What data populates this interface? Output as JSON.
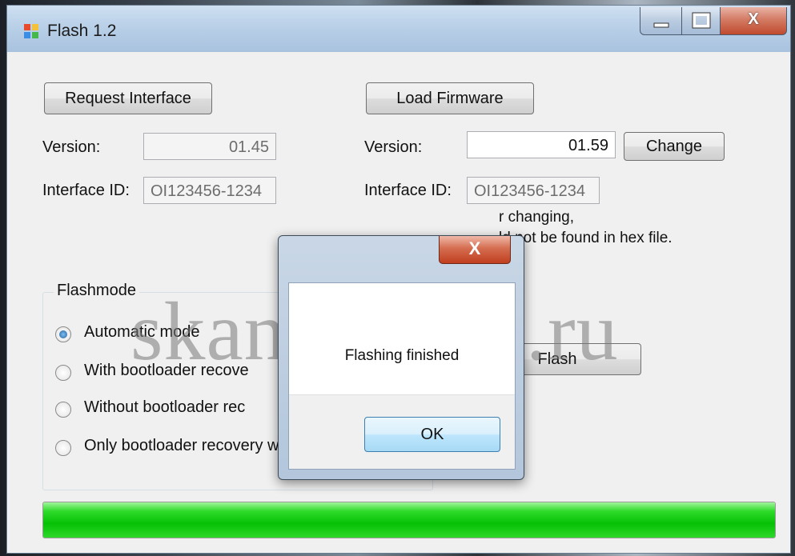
{
  "window": {
    "title": "Flash 1.2",
    "minimize_icon": "minimize-icon",
    "maximize_icon": "maximize-icon",
    "close_icon": "close-icon",
    "close_glyph": "X"
  },
  "left": {
    "request_button": "Request Interface",
    "version_label": "Version:",
    "version_value": "01.45",
    "interface_label": "Interface ID:",
    "interface_value": "OI123456-1234"
  },
  "right": {
    "load_button": "Load Firmware",
    "version_label": "Version:",
    "version_value": "01.59",
    "change_button": "Change",
    "interface_label": "Interface ID:",
    "interface_value": "OI123456-1234",
    "note_line1": "r changing,",
    "note_line2": "ld not be found in hex file."
  },
  "flashmode": {
    "title": "Flashmode",
    "options": [
      {
        "label": "Automatic mode",
        "checked": true
      },
      {
        "label": "With bootloader recove",
        "checked": false
      },
      {
        "label": "Without bootloader rec",
        "checked": false
      },
      {
        "label": "Only bootloader recovery without FW flash",
        "checked": false
      }
    ]
  },
  "flash_button": "Flash",
  "progress": {
    "percent": 100,
    "color": "#06c106"
  },
  "watermark": "skaner-avto.ru",
  "dialog": {
    "close_glyph": "X",
    "message": "Flashing finished",
    "ok_button": "OK"
  }
}
